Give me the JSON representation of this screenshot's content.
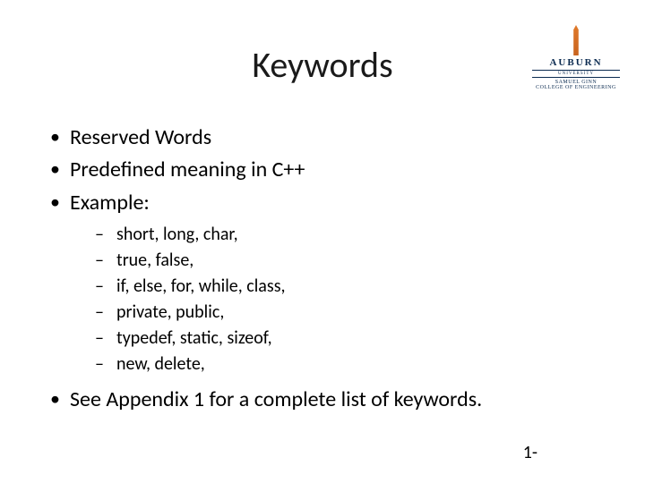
{
  "logo": {
    "university": "AUBURN",
    "line1": "UNIVERSITY",
    "line2": "SAMUEL GINN",
    "line3": "COLLEGE OF ENGINEERING"
  },
  "title": "Keywords",
  "bullets": {
    "b1": "Reserved Words",
    "b2": "Predefined meaning in C++",
    "b3": "Example:",
    "b4": "See Appendix 1 for a complete list of keywords."
  },
  "sub": {
    "s1": " short, long, char,",
    "s2": "true, false,",
    "s3": "if, else, for, while, class,",
    "s4": "private, public,",
    "s5": "typedef, static, sizeof,",
    "s6": "new, delete,"
  },
  "footer": "1-"
}
